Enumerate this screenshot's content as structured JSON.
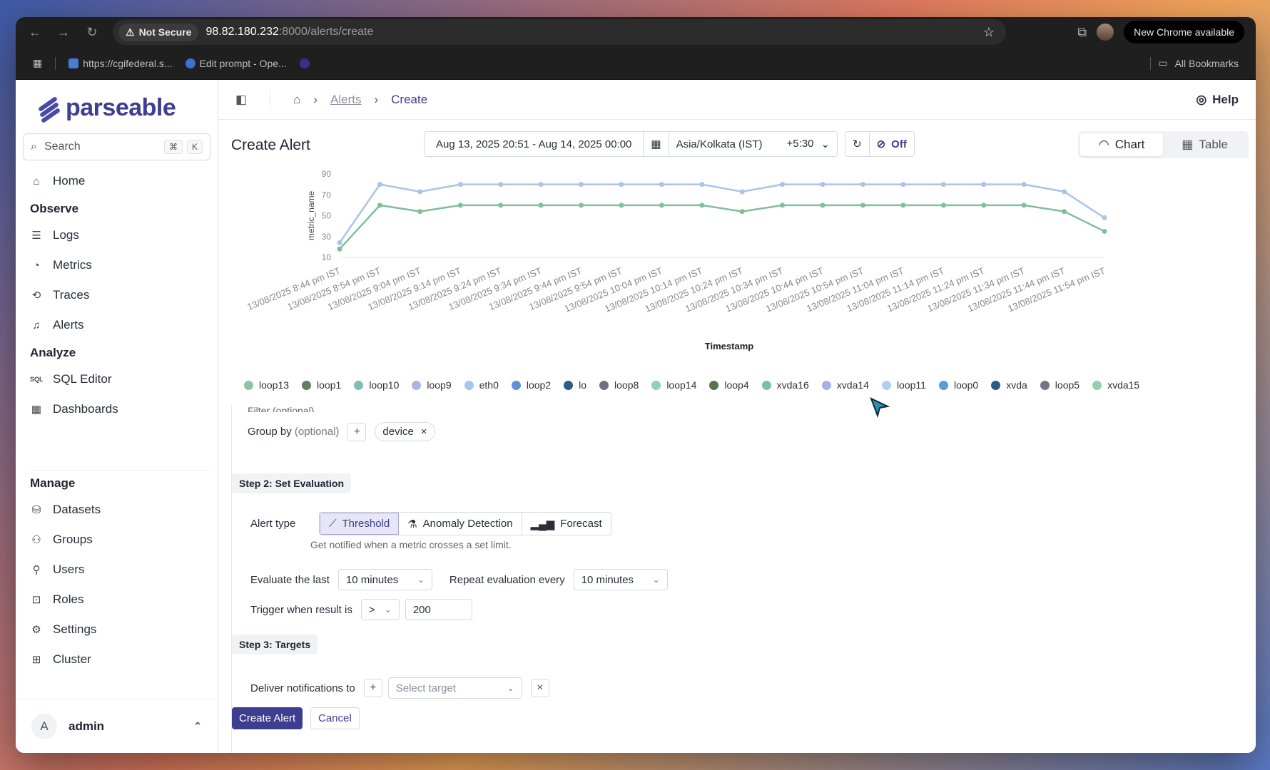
{
  "browser": {
    "security_label": "Not Secure",
    "url_host": "98.82.180.232",
    "url_rest": ":8000/alerts/create",
    "update_label": "New Chrome available",
    "bookmarks": [
      {
        "label": "https://cgifederal.s...",
        "color": "#4a7bd9"
      },
      {
        "label": "Edit prompt - Ope...",
        "color": "#3f6fd6"
      }
    ],
    "all_bookmarks": "All Bookmarks"
  },
  "sidebar": {
    "logo": "parseable",
    "search_placeholder": "Search",
    "search_kbd": [
      "⌘",
      "K"
    ],
    "home": "Home",
    "observe_title": "Observe",
    "observe_items": [
      "Logs",
      "Metrics",
      "Traces",
      "Alerts"
    ],
    "analyze_title": "Analyze",
    "analyze_items": [
      "SQL Editor",
      "Dashboards"
    ],
    "manage_title": "Manage",
    "manage_items": [
      "Datasets",
      "Groups",
      "Users",
      "Roles",
      "Settings",
      "Cluster"
    ],
    "user_initial": "A",
    "user_name": "admin"
  },
  "topbar": {
    "crumb_alerts": "Alerts",
    "crumb_current": "Create",
    "help": "Help"
  },
  "header": {
    "title": "Create Alert",
    "date_range": "Aug 13, 2025 20:51 - Aug 14, 2025 00:00",
    "timezone": "Asia/Kolkata (IST)",
    "offset": "+5:30",
    "auto_refresh": "Off",
    "view_chart": "Chart",
    "view_table": "Table"
  },
  "chart_data": {
    "type": "line",
    "xlabel": "Timestamp",
    "ylabel": "metric_name",
    "yticks": [
      10,
      30,
      50,
      70,
      90
    ],
    "ylim": [
      10,
      90
    ],
    "grid": false,
    "categories": [
      "13/08/2025 8:44 pm IST",
      "13/08/2025 8:54 pm IST",
      "13/08/2025 9:04 pm IST",
      "13/08/2025 9:14 pm IST",
      "13/08/2025 9:24 pm IST",
      "13/08/2025 9:34 pm IST",
      "13/08/2025 9:44 pm IST",
      "13/08/2025 9:54 pm IST",
      "13/08/2025 10:04 pm IST",
      "13/08/2025 10:14 pm IST",
      "13/08/2025 10:24 pm IST",
      "13/08/2025 10:34 pm IST",
      "13/08/2025 10:44 pm IST",
      "13/08/2025 10:54 pm IST",
      "13/08/2025 11:04 pm IST",
      "13/08/2025 11:14 pm IST",
      "13/08/2025 11:24 pm IST",
      "13/08/2025 11:34 pm IST",
      "13/08/2025 11:44 pm IST",
      "13/08/2025 11:54 pm IST"
    ],
    "series": [
      {
        "color": "#a9c4e8",
        "values": [
          24,
          80,
          73,
          80,
          80,
          80,
          80,
          80,
          80,
          80,
          73,
          80,
          80,
          80,
          80,
          80,
          80,
          80,
          73,
          48
        ]
      },
      {
        "color": "#7fbf9b",
        "values": [
          18,
          60,
          54,
          60,
          60,
          60,
          60,
          60,
          60,
          60,
          54,
          60,
          60,
          60,
          60,
          60,
          60,
          60,
          54,
          35
        ]
      }
    ],
    "legend": [
      {
        "name": "loop13",
        "color": "#8cc3a3"
      },
      {
        "name": "loop1",
        "color": "#5f7f63"
      },
      {
        "name": "loop10",
        "color": "#7fbfb5"
      },
      {
        "name": "loop9",
        "color": "#a9b4e3"
      },
      {
        "name": "eth0",
        "color": "#a9c4ee"
      },
      {
        "name": "loop2",
        "color": "#5f90d6"
      },
      {
        "name": "lo",
        "color": "#2c5d8a"
      },
      {
        "name": "loop8",
        "color": "#6f7285"
      },
      {
        "name": "loop14",
        "color": "#94cfae"
      },
      {
        "name": "loop4",
        "color": "#58744f"
      },
      {
        "name": "xvda16",
        "color": "#79bfae"
      },
      {
        "name": "xvda14",
        "color": "#a7b1e3"
      },
      {
        "name": "loop11",
        "color": "#b3cdf0"
      },
      {
        "name": "loop0",
        "color": "#5f9ad8"
      },
      {
        "name": "xvda",
        "color": "#2d5a8a"
      },
      {
        "name": "loop5",
        "color": "#737688"
      },
      {
        "name": "xvda15",
        "color": "#94cfae"
      }
    ]
  },
  "form": {
    "filter_partial": "Filter (optional)",
    "group_by_label": "Group by",
    "group_by_optional": "(optional)",
    "group_by_value": "device",
    "step2": "Step 2: Set Evaluation",
    "alert_type_label": "Alert type",
    "alert_types": [
      "Threshold",
      "Anomaly Detection",
      "Forecast"
    ],
    "alert_type_help": "Get notified when a metric crosses a set limit.",
    "evaluate_label": "Evaluate the last",
    "evaluate_value": "10 minutes",
    "repeat_label": "Repeat evaluation every",
    "repeat_value": "10 minutes",
    "trigger_label": "Trigger when result is",
    "trigger_op": ">",
    "trigger_value": "200",
    "step3": "Step 3: Targets",
    "deliver_label": "Deliver notifications to",
    "target_placeholder": "Select target",
    "create_button": "Create Alert",
    "cancel_button": "Cancel"
  }
}
